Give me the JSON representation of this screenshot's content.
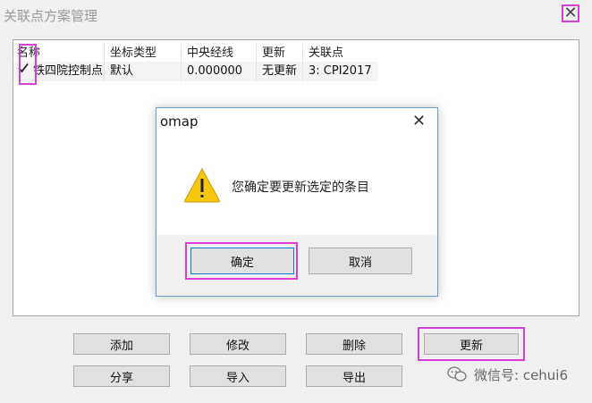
{
  "window": {
    "title": "关联点方案管理",
    "close_glyph": "✕"
  },
  "table": {
    "columns": [
      "名称",
      "坐标类型",
      "中央经线",
      "更新",
      "关联点"
    ],
    "rows": [
      {
        "checked": true,
        "cells": [
          "铁四院控制点",
          "默认",
          "0.000000",
          "无更新",
          "3: CPI2017"
        ]
      }
    ]
  },
  "dialog": {
    "title": "omap",
    "close_glyph": "✕",
    "message": "您确定要更新选定的条目",
    "confirm_label": "确定",
    "cancel_label": "取消",
    "icon": "warning-icon"
  },
  "buttons": {
    "add": "添加",
    "modify": "修改",
    "delete": "删除",
    "update": "更新",
    "share": "分享",
    "import": "导入",
    "export": "导出"
  },
  "watermark": {
    "text": "微信号: cehui6",
    "icon": "wechat-icon"
  },
  "colors": {
    "highlight": "#d63fd6",
    "warning": "#f7c70f",
    "dialog_border": "#6c9bd2"
  }
}
